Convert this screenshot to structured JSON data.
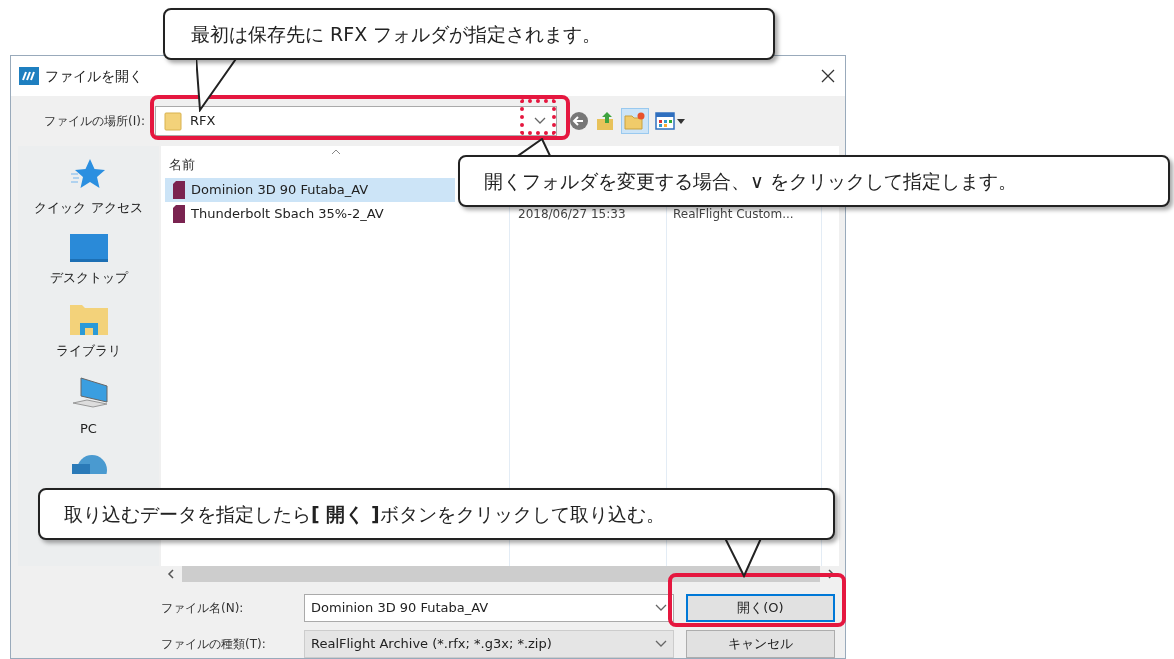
{
  "window": {
    "title": "ファイルを開く"
  },
  "location": {
    "label": "ファイルの場所(I):",
    "value": "RFX"
  },
  "sidebar": {
    "items": [
      {
        "kind": "star",
        "label": "クイック アクセス"
      },
      {
        "kind": "desktop",
        "label": "デスクトップ"
      },
      {
        "kind": "library",
        "label": "ライブラリ"
      },
      {
        "kind": "pc",
        "label": "PC"
      },
      {
        "kind": "network"
      }
    ]
  },
  "file_list": {
    "columns": [
      {
        "label": "名前"
      }
    ],
    "rows": [
      {
        "name": "Dominion 3D 90 Futaba_AV",
        "selected": true
      },
      {
        "name": "Thunderbolt Sbach 35%-2_AV",
        "date": "2018/06/27 15:33",
        "type": "RealFlight Custom...",
        "selected": false
      }
    ]
  },
  "file_name": {
    "label": "ファイル名(N):",
    "value": "Dominion 3D 90 Futaba_AV"
  },
  "file_type": {
    "label": "ファイルの種類(T):",
    "value": "RealFlight Archive (*.rfx; *.g3x; *.zip)"
  },
  "buttons": [
    {
      "label": "開く(O)",
      "default": true
    },
    {
      "label": "キャンセル",
      "default": false
    }
  ],
  "annotations": [
    {
      "text": "最初は保存先に RFX フォルダが指定されます。"
    },
    {
      "text": "開くフォルダを変更する場合、∨ をクリックして指定します。"
    },
    {
      "text": "取り込むデータを指定したら**[ 開く ]**ボタンをクリックして取り込む。"
    }
  ]
}
